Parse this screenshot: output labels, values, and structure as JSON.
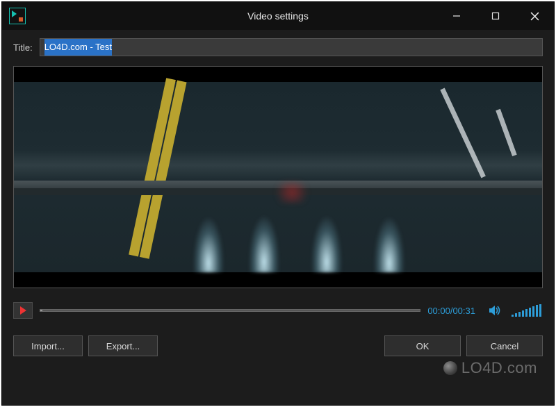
{
  "window": {
    "title": "Video settings"
  },
  "titleField": {
    "label": "Title:",
    "value": "LO4D.com - Test"
  },
  "playback": {
    "current_time": "00:00",
    "duration": "00:31",
    "time_display": "00:00/00:31"
  },
  "buttons": {
    "import": "Import...",
    "export": "Export...",
    "ok": "OK",
    "cancel": "Cancel"
  },
  "watermark": "LO4D.com",
  "icons": {
    "minimize": "─",
    "maximize": "☐",
    "close": "✕",
    "speaker": "🔊"
  }
}
